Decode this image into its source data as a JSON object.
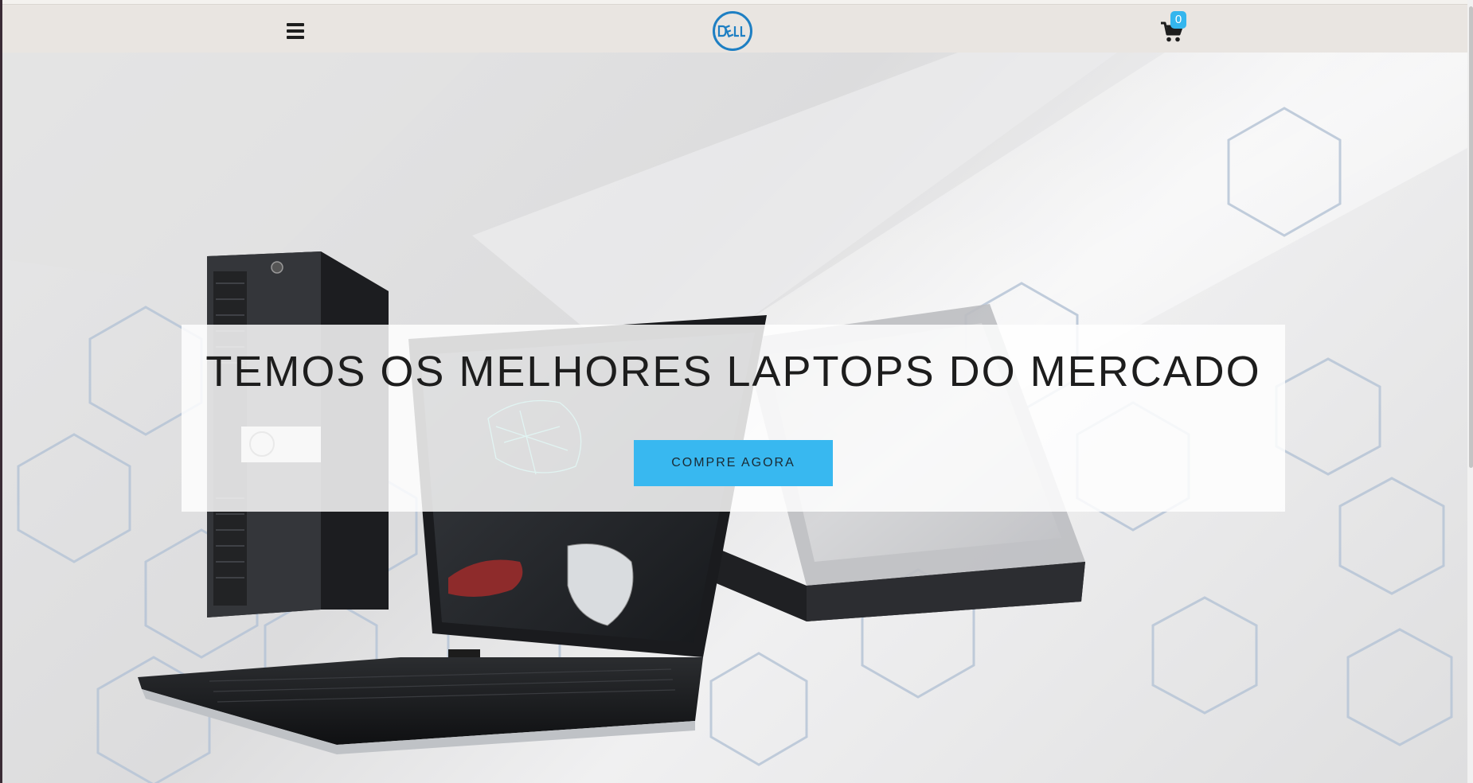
{
  "header": {
    "menu_icon": "hamburger-menu-icon",
    "logo_text": "DELL",
    "cart_icon": "shopping-cart-icon",
    "cart_count": "0"
  },
  "hero": {
    "title": "TEMOS OS MELHORES LAPTOPS DO MERCADO",
    "cta_label": "COMPRE AGORA"
  },
  "colors": {
    "accent": "#38b8f0",
    "navbar_bg": "#e9e5e1",
    "dell_blue": "#1e7fc3"
  }
}
